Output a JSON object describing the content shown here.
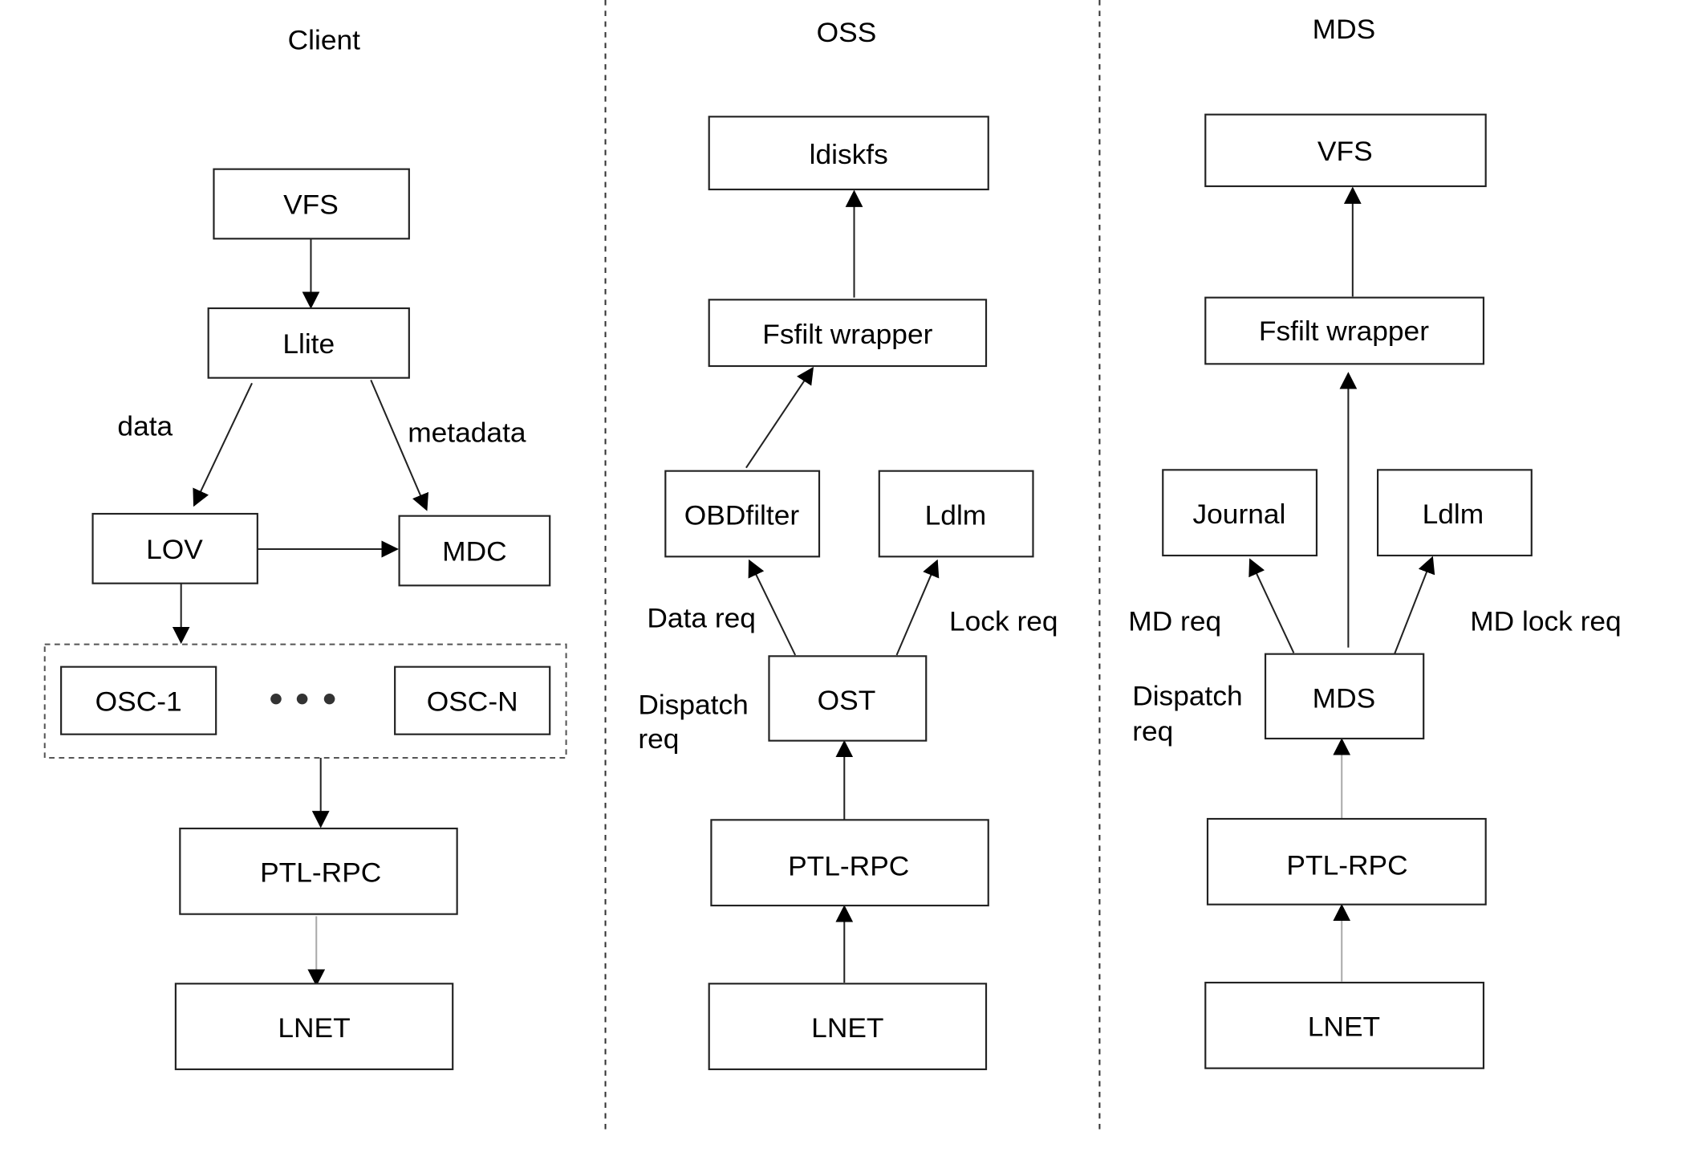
{
  "columns": {
    "client": {
      "title": "Client",
      "nodes": {
        "vfs": "VFS",
        "llite": "Llite",
        "lov": "LOV",
        "mdc": "MDC",
        "osc1": "OSC-1",
        "oscn": "OSC-N",
        "ptlrpc": "PTL-RPC",
        "lnet": "LNET"
      },
      "edge_labels": {
        "data": "data",
        "metadata": "metadata"
      }
    },
    "oss": {
      "title": "OSS",
      "nodes": {
        "ldiskfs": "ldiskfs",
        "fsfilt": "Fsfilt wrapper",
        "obdfilter": "OBDfilter",
        "ldlm": "Ldlm",
        "ost": "OST",
        "ptlrpc": "PTL-RPC",
        "lnet": "LNET"
      },
      "edge_labels": {
        "data_req": "Data req",
        "lock_req": "Lock req",
        "dispatch_1": "Dispatch",
        "dispatch_2": "req"
      }
    },
    "mds": {
      "title": "MDS",
      "nodes": {
        "vfs": "VFS",
        "fsfilt": "Fsfilt wrapper",
        "journal": "Journal",
        "ldlm": "Ldlm",
        "mds": "MDS",
        "ptlrpc": "PTL-RPC",
        "lnet": "LNET"
      },
      "edge_labels": {
        "md_req": "MD req",
        "md_lock_req": "MD lock req",
        "dispatch_1": "Dispatch",
        "dispatch_2": "req"
      }
    }
  }
}
